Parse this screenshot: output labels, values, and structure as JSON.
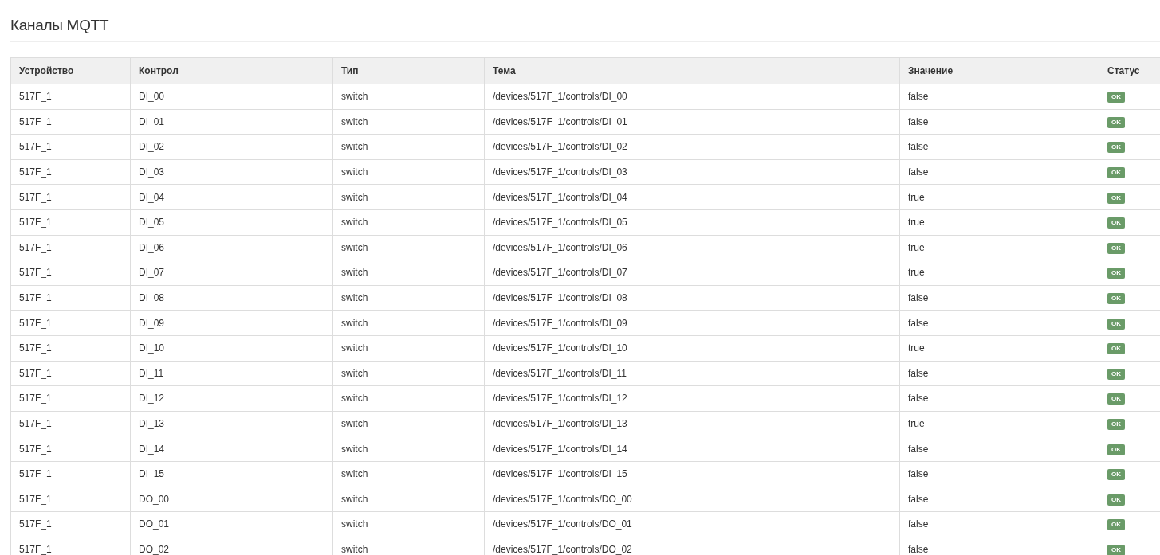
{
  "page": {
    "title": "Каналы MQTT"
  },
  "table": {
    "columns": [
      "Устройство",
      "Контрол",
      "Тип",
      "Тема",
      "Значение",
      "Статус"
    ],
    "rows": [
      {
        "device": "517F_1",
        "control": "DI_00",
        "type": "switch",
        "topic": "/devices/517F_1/controls/DI_00",
        "value": "false",
        "status": {
          "label": "OK",
          "kind": "success"
        }
      },
      {
        "device": "517F_1",
        "control": "DI_01",
        "type": "switch",
        "topic": "/devices/517F_1/controls/DI_01",
        "value": "false",
        "status": {
          "label": "OK",
          "kind": "success"
        }
      },
      {
        "device": "517F_1",
        "control": "DI_02",
        "type": "switch",
        "topic": "/devices/517F_1/controls/DI_02",
        "value": "false",
        "status": {
          "label": "OK",
          "kind": "success"
        }
      },
      {
        "device": "517F_1",
        "control": "DI_03",
        "type": "switch",
        "topic": "/devices/517F_1/controls/DI_03",
        "value": "false",
        "status": {
          "label": "OK",
          "kind": "success"
        }
      },
      {
        "device": "517F_1",
        "control": "DI_04",
        "type": "switch",
        "topic": "/devices/517F_1/controls/DI_04",
        "value": "true",
        "status": {
          "label": "OK",
          "kind": "success"
        }
      },
      {
        "device": "517F_1",
        "control": "DI_05",
        "type": "switch",
        "topic": "/devices/517F_1/controls/DI_05",
        "value": "true",
        "status": {
          "label": "OK",
          "kind": "success"
        }
      },
      {
        "device": "517F_1",
        "control": "DI_06",
        "type": "switch",
        "topic": "/devices/517F_1/controls/DI_06",
        "value": "true",
        "status": {
          "label": "OK",
          "kind": "success"
        }
      },
      {
        "device": "517F_1",
        "control": "DI_07",
        "type": "switch",
        "topic": "/devices/517F_1/controls/DI_07",
        "value": "true",
        "status": {
          "label": "OK",
          "kind": "success"
        }
      },
      {
        "device": "517F_1",
        "control": "DI_08",
        "type": "switch",
        "topic": "/devices/517F_1/controls/DI_08",
        "value": "false",
        "status": {
          "label": "OK",
          "kind": "success"
        }
      },
      {
        "device": "517F_1",
        "control": "DI_09",
        "type": "switch",
        "topic": "/devices/517F_1/controls/DI_09",
        "value": "false",
        "status": {
          "label": "OK",
          "kind": "success"
        }
      },
      {
        "device": "517F_1",
        "control": "DI_10",
        "type": "switch",
        "topic": "/devices/517F_1/controls/DI_10",
        "value": "true",
        "status": {
          "label": "OK",
          "kind": "success"
        }
      },
      {
        "device": "517F_1",
        "control": "DI_11",
        "type": "switch",
        "topic": "/devices/517F_1/controls/DI_11",
        "value": "false",
        "status": {
          "label": "OK",
          "kind": "success"
        }
      },
      {
        "device": "517F_1",
        "control": "DI_12",
        "type": "switch",
        "topic": "/devices/517F_1/controls/DI_12",
        "value": "false",
        "status": {
          "label": "OK",
          "kind": "success"
        }
      },
      {
        "device": "517F_1",
        "control": "DI_13",
        "type": "switch",
        "topic": "/devices/517F_1/controls/DI_13",
        "value": "true",
        "status": {
          "label": "OK",
          "kind": "success"
        }
      },
      {
        "device": "517F_1",
        "control": "DI_14",
        "type": "switch",
        "topic": "/devices/517F_1/controls/DI_14",
        "value": "false",
        "status": {
          "label": "OK",
          "kind": "success"
        }
      },
      {
        "device": "517F_1",
        "control": "DI_15",
        "type": "switch",
        "topic": "/devices/517F_1/controls/DI_15",
        "value": "false",
        "status": {
          "label": "OK",
          "kind": "success"
        }
      },
      {
        "device": "517F_1",
        "control": "DO_00",
        "type": "switch",
        "topic": "/devices/517F_1/controls/DO_00",
        "value": "false",
        "status": {
          "label": "OK",
          "kind": "success"
        }
      },
      {
        "device": "517F_1",
        "control": "DO_01",
        "type": "switch",
        "topic": "/devices/517F_1/controls/DO_01",
        "value": "false",
        "status": {
          "label": "OK",
          "kind": "success"
        }
      },
      {
        "device": "517F_1",
        "control": "DO_02",
        "type": "switch",
        "topic": "/devices/517F_1/controls/DO_02",
        "value": "false",
        "status": {
          "label": "OK",
          "kind": "success"
        }
      }
    ]
  }
}
